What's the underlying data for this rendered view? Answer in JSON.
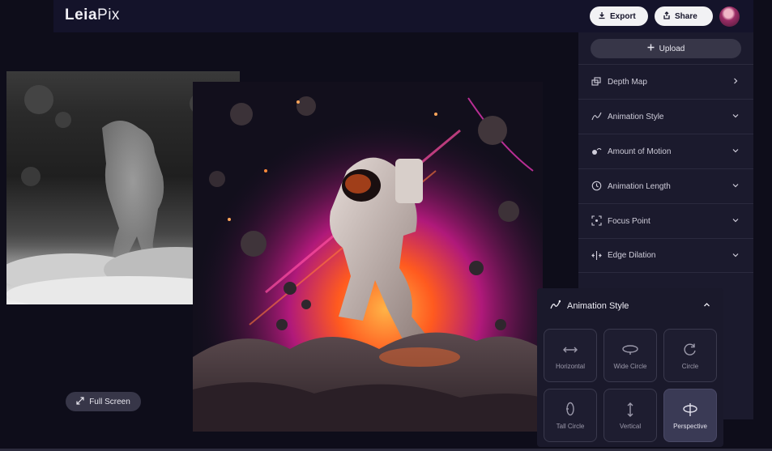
{
  "app": {
    "logo_main": "Leia",
    "logo_sub": "Pix"
  },
  "header": {
    "export_label": "Export",
    "share_label": "Share"
  },
  "panel": {
    "upload_label": "Upload",
    "rows": [
      {
        "label": "Depth Map",
        "icon": "layers-icon",
        "chevron": "chevron-right-icon"
      },
      {
        "label": "Animation Style",
        "icon": "animation-style-icon",
        "chevron": "chevron-down-icon"
      },
      {
        "label": "Amount of Motion",
        "icon": "motion-icon",
        "chevron": "chevron-down-icon"
      },
      {
        "label": "Animation Length",
        "icon": "clock-icon",
        "chevron": "chevron-down-icon"
      },
      {
        "label": "Focus Point",
        "icon": "focus-icon",
        "chevron": "chevron-down-icon"
      },
      {
        "label": "Edge Dilation",
        "icon": "edge-dilation-icon",
        "chevron": "chevron-down-icon"
      }
    ]
  },
  "viewer": {
    "fullscreen_label": "Full Screen"
  },
  "animation_popover": {
    "title": "Animation Style",
    "options": [
      {
        "label": "Horizontal",
        "icon": "horizontal-arrows-icon",
        "active": false
      },
      {
        "label": "Wide Circle",
        "icon": "wide-circle-icon",
        "active": false
      },
      {
        "label": "Circle",
        "icon": "circle-icon",
        "active": false
      },
      {
        "label": "Tall Circle",
        "icon": "tall-circle-icon",
        "active": false
      },
      {
        "label": "Vertical",
        "icon": "vertical-arrows-icon",
        "active": false
      },
      {
        "label": "Perspective",
        "icon": "perspective-icon",
        "active": true
      }
    ]
  },
  "colors": {
    "background": "#0e0d1a",
    "panel": "#1b1a2d",
    "pill_light": "#f2f2f4",
    "pill_dark": "#373648",
    "active_tile": "#3a3a55"
  }
}
